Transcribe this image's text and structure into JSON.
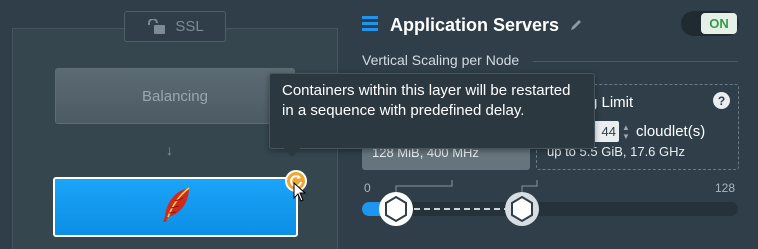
{
  "left": {
    "ssl_label": "SSL",
    "balancing_label": "Balancing",
    "app_node_icon": "feather-icon",
    "restart_badge_icon": "restart-icon",
    "arrow_icon": "arrow-down-icon"
  },
  "header": {
    "title": "Application Servers",
    "menu_icon": "hamburger-icon",
    "edit_icon": "pencil-icon",
    "toggle_label": "ON",
    "toggle_color": "#2f9e44"
  },
  "scaling": {
    "section_label": "Vertical Scaling per Node",
    "reserved_summary": "128 MiB, 400 MHz",
    "limit_title": "g Limit",
    "limit_value": "44",
    "limit_unit": "cloudlet(s)",
    "limit_summary": "up to 5.5 GiB, 17.6 GHz",
    "help_icon": "question-icon",
    "scale_min": "0",
    "scale_max": "128"
  },
  "tooltip": {
    "text": "Containers within this layer will be restarted in a sequence with predefined delay."
  },
  "colors": {
    "accent": "#1aa4f8",
    "badge": "#f2a531",
    "background": "#2f3e48"
  }
}
